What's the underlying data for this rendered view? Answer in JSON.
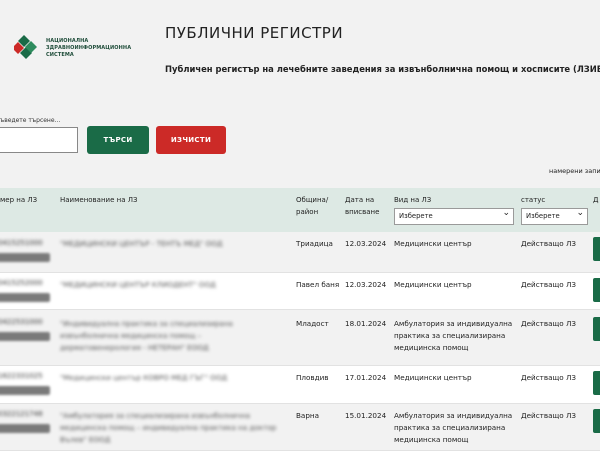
{
  "logo": {
    "lines": [
      "НАЦИОНАЛНА",
      "ЗДРАВНОИНФОРМАЦИОННА",
      "СИСТЕМА"
    ],
    "colors": {
      "green": "#1a6b47",
      "red": "#cc2a27"
    }
  },
  "header": {
    "title": "ПУБЛИЧНИ РЕГИСТРИ",
    "subtitle": "Публичен регистър на лечебните заведения за извънболнична помощ и хосписите (ЛЗИБПХ)"
  },
  "search": {
    "label": "ъведете търсене...",
    "value": "",
    "search_button": "ТЪРСИ",
    "clear_button": "ИЗЧИСТИ"
  },
  "results": {
    "found_text": "намерени запис"
  },
  "table": {
    "headers": {
      "reg_number": "мер на ЛЗ",
      "name": "Наименование на ЛЗ",
      "municipality": "Община/ район",
      "date": "Дата на вписване",
      "type": "Вид на ЛЗ",
      "status": "статус",
      "actions": "Д"
    },
    "filters": {
      "type_selected": "Изберете",
      "status_selected": "Изберете"
    },
    "rows": [
      {
        "reg": "0415251000",
        "badge": "РЕГ. ЗАБ",
        "name": "\"МЕДИЦИНСКИ ЦЕНТЪР - ТЕНТЪ МЕД\" ООД",
        "municipality": "Триадица",
        "date": "12.03.2024",
        "type": "Медицински център",
        "status": "Действащо ЛЗ"
      },
      {
        "reg": "0415252000",
        "badge": "РЕГ. ЗАБ",
        "name": "\"МЕДИЦИНСКИ ЦЕНТЪР КЛИОДЕНТ\" ООД",
        "municipality": "Павел баня",
        "date": "12.03.2024",
        "type": "Медицински център",
        "status": "Действащо ЛЗ"
      },
      {
        "reg": "0422531000",
        "badge": "РЕГ. ЗАБ",
        "name": "\"Индивидуална практика за специализирана извънболнична медицинска помощ – дерматовенерология - НЕТЕРАН\" ЕООД",
        "municipality": "Младост",
        "date": "18.01.2024",
        "type": "Амбулатория за индивидуална практика за специализирана медицинска помощ",
        "status": "Действащо ЛЗ"
      },
      {
        "reg": "1622331025",
        "badge": "РЕГ. ЗАБ",
        "name": "\"Медицински център КОВРО МЕД ГЪГ\" ООД",
        "municipality": "Пловдив",
        "date": "17.01.2024",
        "type": "Медицински център",
        "status": "Действащо ЛЗ"
      },
      {
        "reg": "0322121748",
        "badge": "РЕГ. ЗАБ",
        "name": "\"Амбулатория за специализирана извънболнична медицинска помощ – индивидуална практика на доктор Вълев\" ЕООД",
        "municipality": "Варна",
        "date": "15.01.2024",
        "type": "Амбулатория за индивидуална практика за специализирана медицинска помощ",
        "status": "Действащо ЛЗ"
      }
    ]
  }
}
